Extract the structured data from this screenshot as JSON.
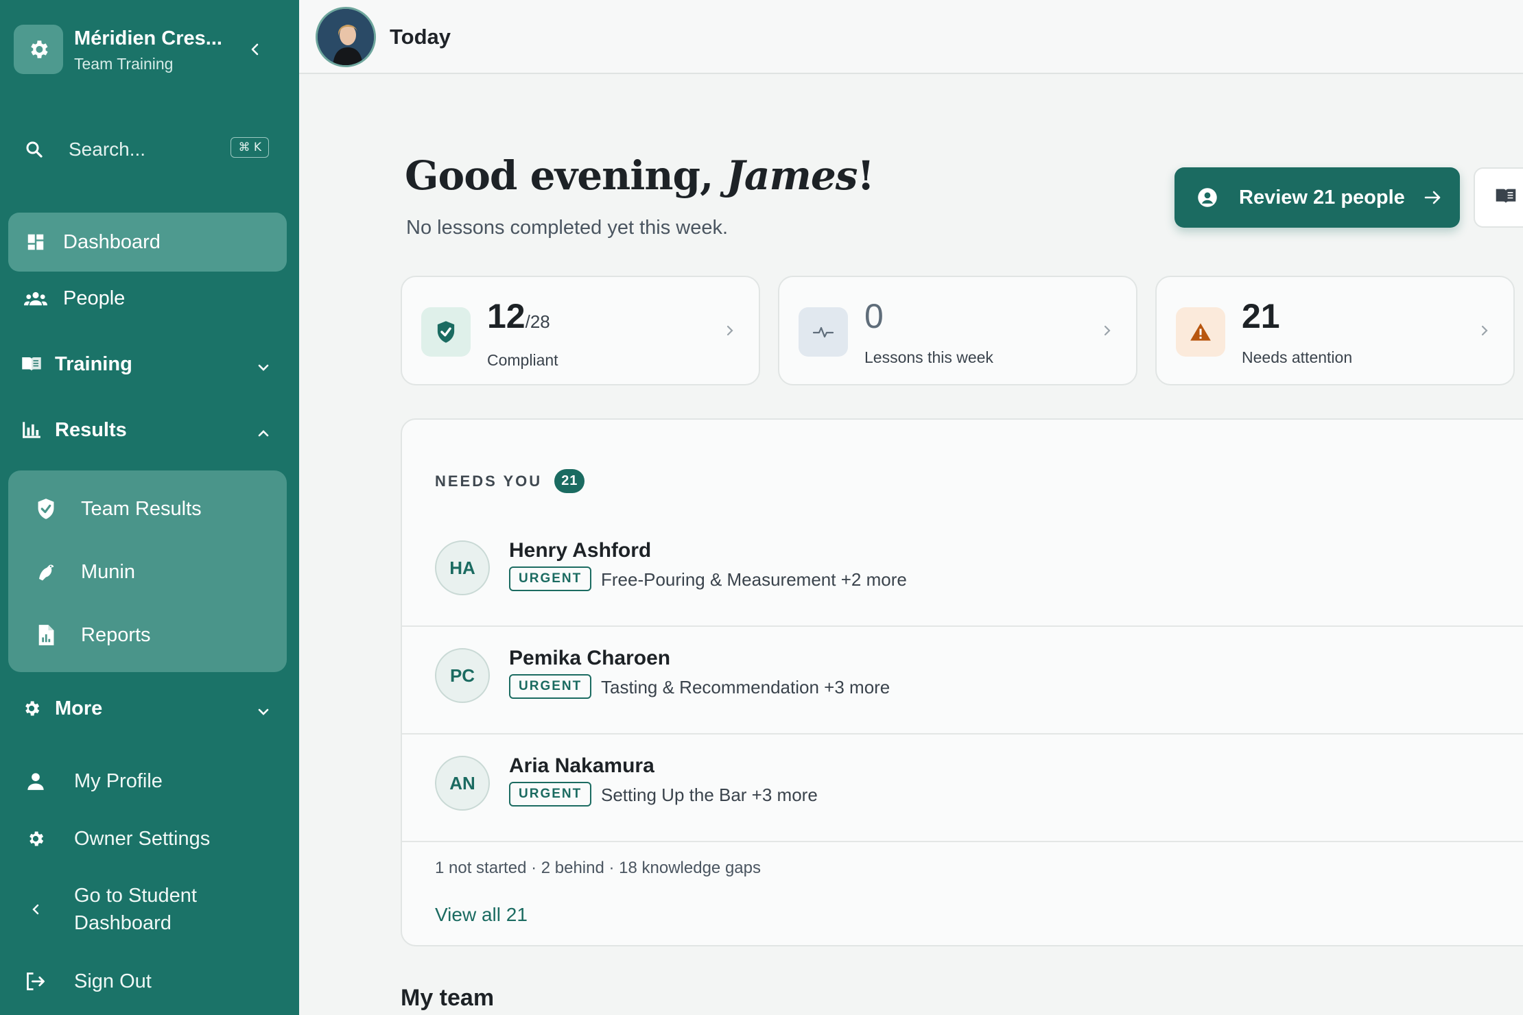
{
  "sidebar": {
    "org_name": "Méridien Cres...",
    "org_sub": "Team Training",
    "search_placeholder": "Search...",
    "search_shortcut": "⌘ K",
    "nav": {
      "dashboard": "Dashboard",
      "people": "People",
      "training": "Training",
      "results": "Results",
      "team_results": "Team Results",
      "munin": "Munin",
      "reports": "Reports",
      "more": "More"
    },
    "footer": {
      "my_profile": "My Profile",
      "owner_settings": "Owner Settings",
      "student_dashboard_line1": "Go to Student",
      "student_dashboard_line2": "Dashboard",
      "sign_out": "Sign Out"
    }
  },
  "topbar": {
    "title": "Today"
  },
  "greeting": {
    "prefix": "Good evening, ",
    "name": "James",
    "suffix": "!",
    "subtitle": "No lessons completed yet this week.",
    "review_button": "Review 21 people"
  },
  "stats": [
    {
      "value": "12",
      "total": "/28",
      "label": "Compliant"
    },
    {
      "value": "0",
      "label": "Lessons this week"
    },
    {
      "value": "21",
      "label": "Needs attention"
    }
  ],
  "needs_you": {
    "title": "NEEDS YOU",
    "count": "21",
    "people": [
      {
        "initials": "HA",
        "name": "Henry Ashford",
        "status": "URGENT",
        "detail": "Free-Pouring & Measurement +2 more"
      },
      {
        "initials": "PC",
        "name": "Pemika Charoen",
        "status": "URGENT",
        "detail": "Tasting & Recommendation +3 more"
      },
      {
        "initials": "AN",
        "name": "Aria Nakamura",
        "status": "URGENT",
        "detail": "Setting Up the Bar +3 more"
      }
    ],
    "summary": "1 not started · 2 behind · 18 knowledge gaps",
    "view_all": "View all 21"
  },
  "my_team": {
    "title": "My team"
  },
  "colors": {
    "sidebar": "#1b7368",
    "accent": "#1b6b61",
    "warning": "#b8560f"
  }
}
